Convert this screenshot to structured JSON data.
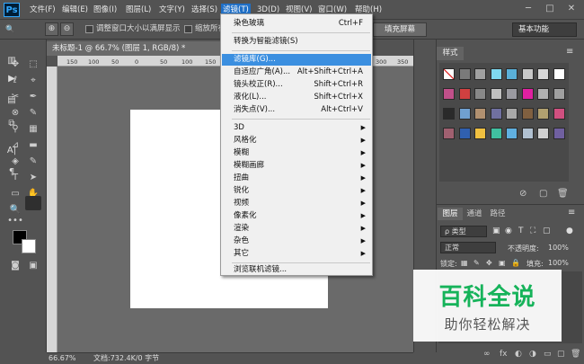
{
  "app": {
    "logo": "Ps"
  },
  "menubar": {
    "items": [
      {
        "label": "文件(F)"
      },
      {
        "label": "编辑(E)"
      },
      {
        "label": "图像(I)"
      },
      {
        "label": "图层(L)"
      },
      {
        "label": "文字(Y)"
      },
      {
        "label": "选择(S)"
      },
      {
        "label": "滤镜(T)"
      },
      {
        "label": "3D(D)"
      },
      {
        "label": "视图(V)"
      },
      {
        "label": "窗口(W)"
      },
      {
        "label": "帮助(H)"
      }
    ],
    "active_index": 6
  },
  "window_controls": {
    "minimize": "─",
    "maximize": "□",
    "close": "✕"
  },
  "options": {
    "tool_icon": "🔍",
    "zoom_in": "⊕",
    "zoom_out": "⊖",
    "resize_windows_label": "调整窗口大小以满屏显示",
    "zoom_all_label": "缩放所有",
    "fill_screen_label": "填充屏幕",
    "workspace_label": "基本功能"
  },
  "document": {
    "tab_label": "未标题-1 @ 66.7% (图层 1, RGB/8) *",
    "ruler_ticks": [
      "150",
      "100",
      "50",
      "0",
      "50",
      "100",
      "150",
      "200",
      "250",
      "300",
      "350"
    ],
    "status_zoom": "66.67%",
    "status_doc": "文档:732.4K/0 字节"
  },
  "filter_menu": {
    "items": [
      {
        "label": "染色玻璃",
        "shortcut": "Ctrl+F"
      },
      {
        "label": "转换为智能滤镜(S)",
        "shortcut": ""
      },
      {
        "label": "滤镜库(G)...",
        "shortcut": ""
      },
      {
        "label": "自适应广角(A)...",
        "shortcut": "Alt+Shift+Ctrl+A"
      },
      {
        "label": "镜头校正(R)...",
        "shortcut": "Shift+Ctrl+R"
      },
      {
        "label": "液化(L)...",
        "shortcut": "Shift+Ctrl+X"
      },
      {
        "label": "消失点(V)...",
        "shortcut": "Alt+Ctrl+V"
      },
      {
        "label": "3D",
        "submenu": true
      },
      {
        "label": "风格化",
        "submenu": true
      },
      {
        "label": "模糊",
        "submenu": true
      },
      {
        "label": "模糊画廊",
        "submenu": true
      },
      {
        "label": "扭曲",
        "submenu": true
      },
      {
        "label": "锐化",
        "submenu": true
      },
      {
        "label": "视频",
        "submenu": true
      },
      {
        "label": "像素化",
        "submenu": true
      },
      {
        "label": "渲染",
        "submenu": true
      },
      {
        "label": "杂色",
        "submenu": true
      },
      {
        "label": "其它",
        "submenu": true
      },
      {
        "label": "浏览联机滤镜...",
        "shortcut": ""
      }
    ],
    "highlighted_index": 2,
    "submenu_arrow": "▶"
  },
  "styles_panel": {
    "tab_label": "样式",
    "menu_icon": "≡",
    "swatch_colors": [
      "#ffffff",
      "#7a7a7a",
      "#a0a0a0",
      "#7fd9f0",
      "#5ab0d8",
      "#c8c8c8",
      "#d8d8d8",
      "#ffffff",
      "#c0508a",
      "#d04040",
      "#888888",
      "#c0c0c0",
      "#9a9aa0",
      "#e020a0",
      "#b0b0b0",
      "#a0a0a0",
      "#2a2a2a",
      "#70a0d0",
      "#b09070",
      "#7070a0",
      "#a8a8a8",
      "#806040",
      "#b0a070",
      "#d05080",
      "#a06070",
      "#3060b0",
      "#f0c040",
      "#40c0a0",
      "#60b0e0",
      "#b0c0d0",
      "#d0d0d0",
      "#7060a0"
    ],
    "footer_icons": [
      "⊘",
      "▢",
      "🗑"
    ]
  },
  "layers_panel": {
    "tabs": [
      {
        "label": "图层"
      },
      {
        "label": "通道"
      },
      {
        "label": "路径"
      }
    ],
    "menu_icon": "≡",
    "kind_label": "ρ 类型",
    "filter_icons": [
      "▣",
      "◉",
      "T",
      "⛶",
      "▢",
      "●"
    ],
    "blend_mode": "正常",
    "opacity_label": "不透明度:",
    "opacity_value": "100%",
    "lock_label": "锁定:",
    "lock_icons": [
      "▦",
      "✎",
      "✥",
      "▣",
      "🔒"
    ],
    "fill_label": "填充:",
    "fill_value": "100%",
    "footer_icons": [
      "∞",
      "fx",
      "◐",
      "◑",
      "▭",
      "▢",
      "🗑"
    ]
  },
  "tools": [
    "✥",
    "⬚",
    "ℓ",
    "⌖",
    "✂",
    "✒",
    "⊗",
    "✎",
    "⚲",
    "▦",
    "⊿",
    "▬",
    "◈",
    "✎",
    "T",
    "➤",
    "▭",
    "✋",
    "🔍",
    "•••"
  ],
  "watermark": {
    "title": "百科全说",
    "subtitle": "助你轻松解决"
  }
}
